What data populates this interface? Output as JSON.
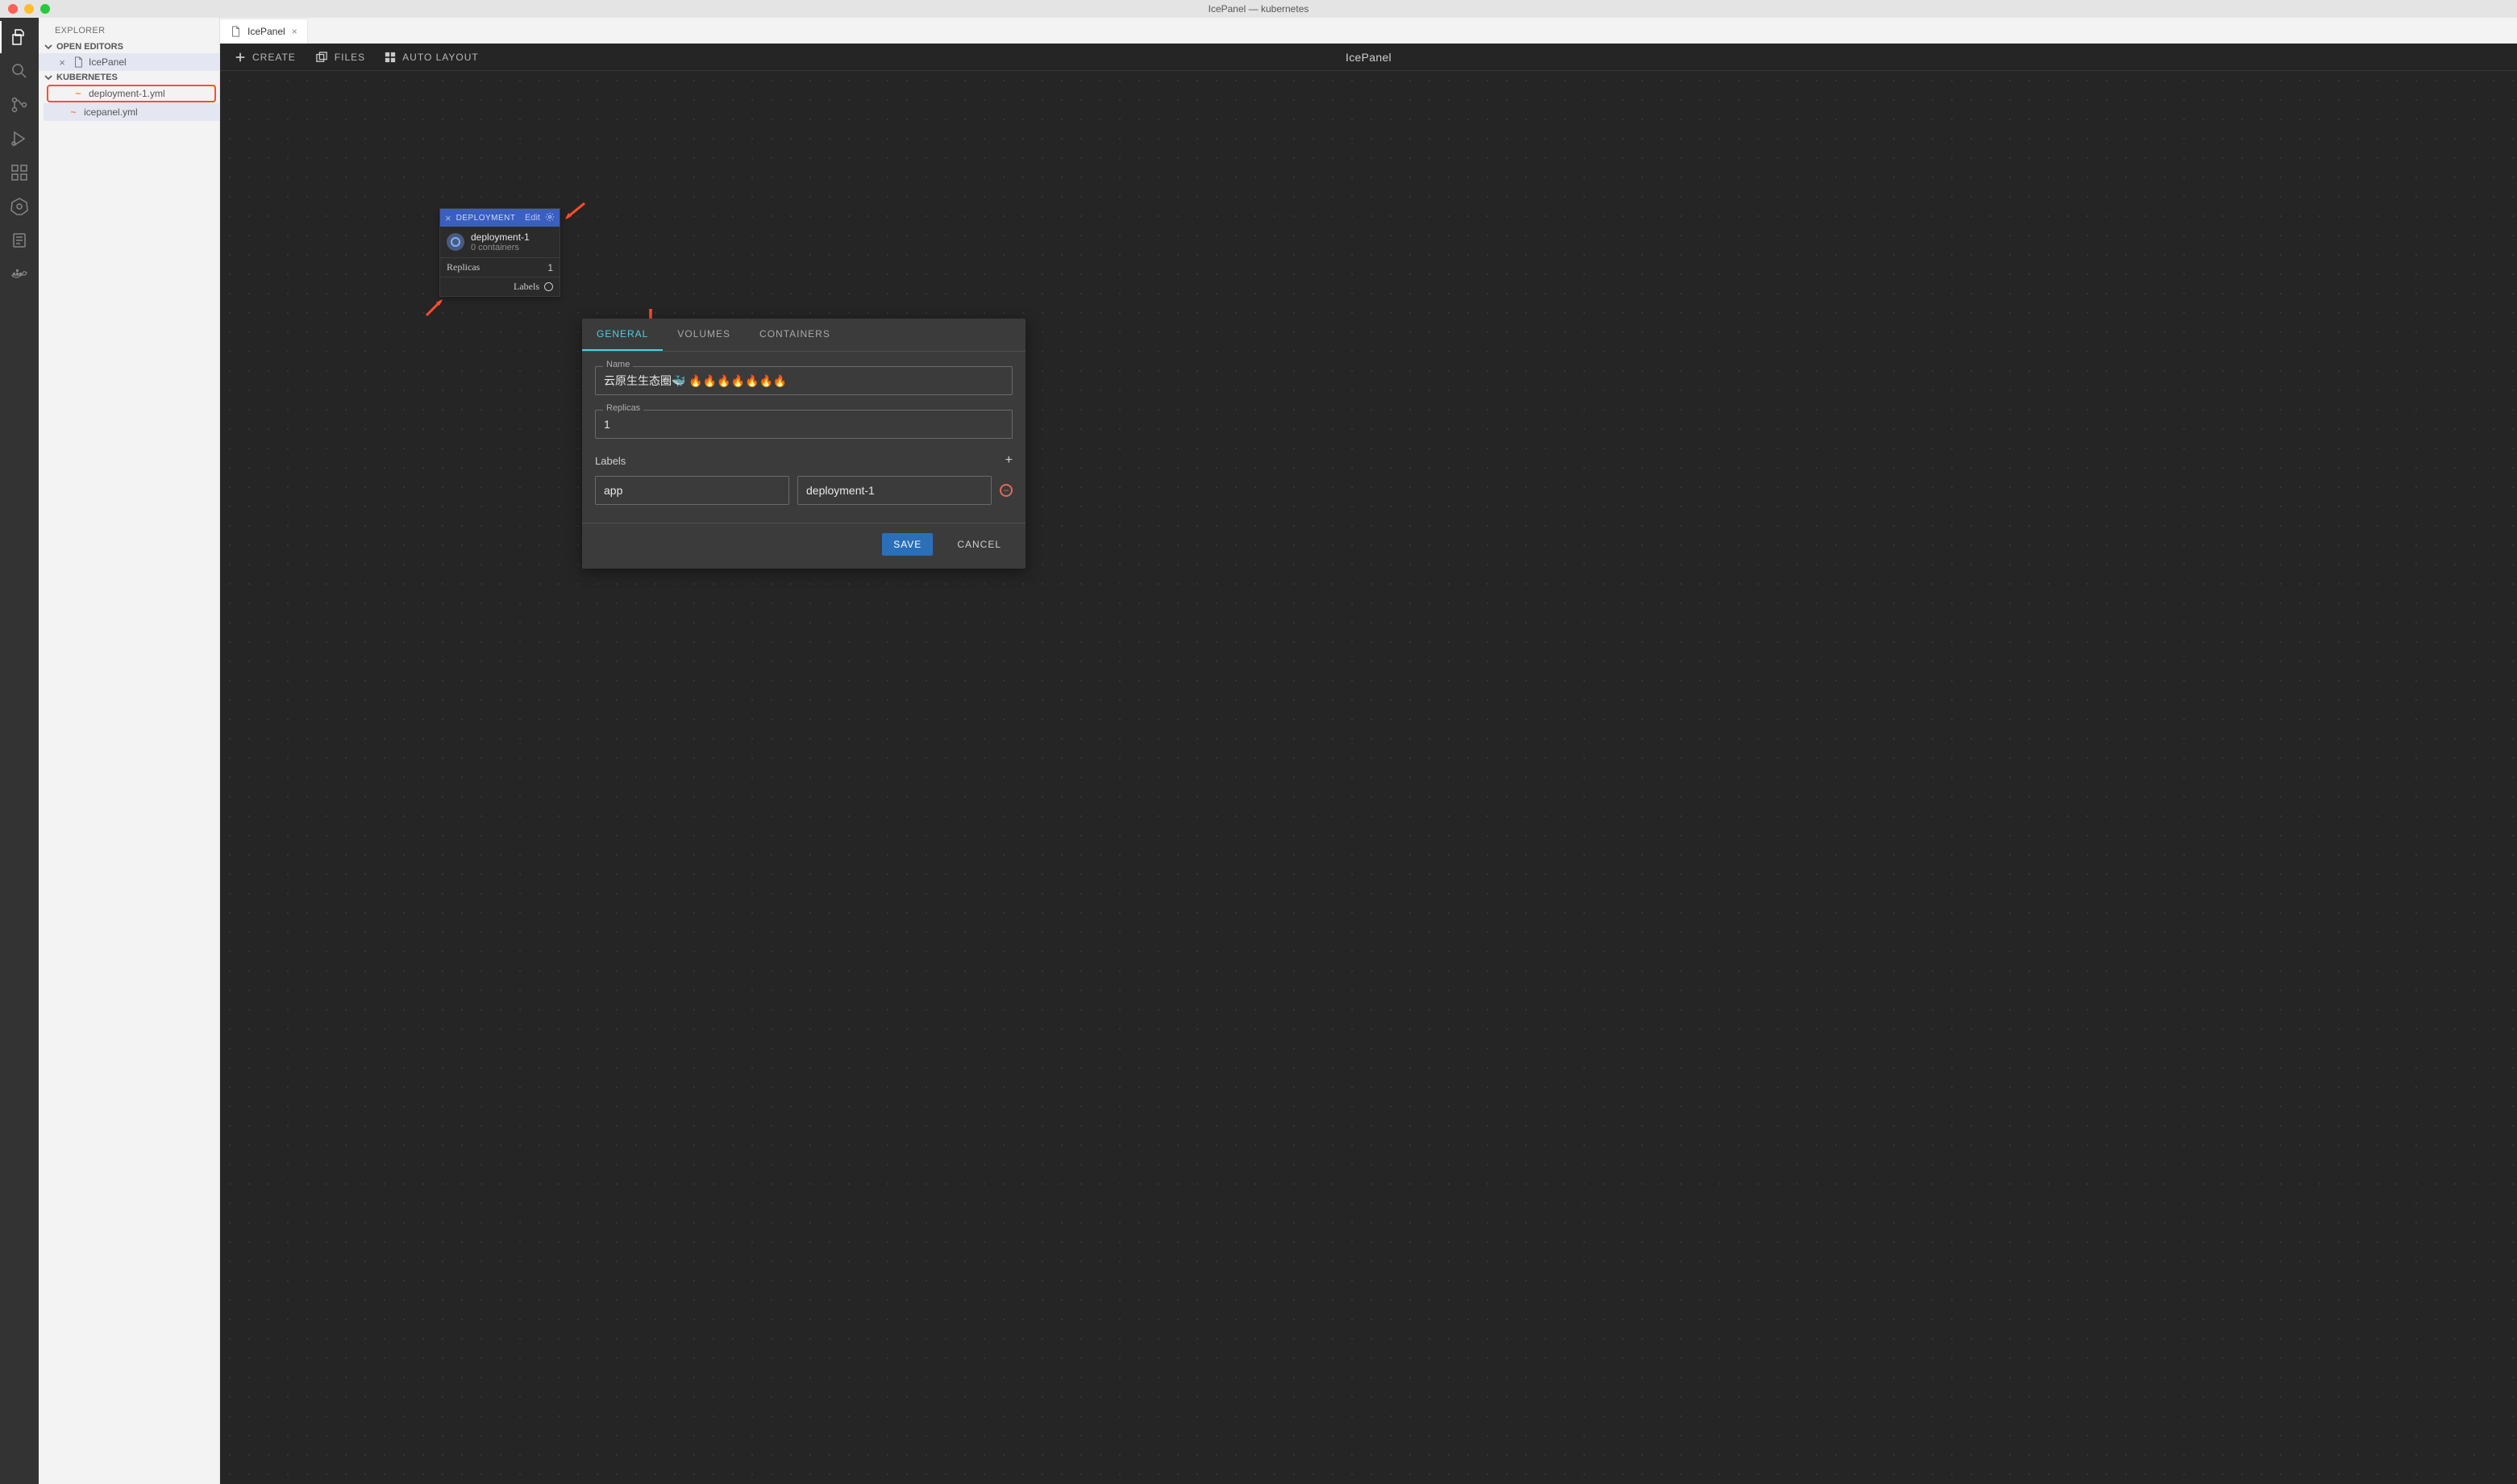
{
  "window": {
    "title": "IcePanel — kubernetes"
  },
  "sidebar": {
    "title": "EXPLORER",
    "open_editors": {
      "header": "OPEN EDITORS",
      "items": [
        {
          "label": "IcePanel"
        }
      ]
    },
    "workspace": {
      "header": "KUBERNETES",
      "files": [
        {
          "label": "deployment-1.yml",
          "highlighted": true
        },
        {
          "label": "icepanel.yml"
        }
      ]
    }
  },
  "tabs": [
    {
      "label": "IcePanel"
    }
  ],
  "toolbar": {
    "create": "CREATE",
    "files": "FILES",
    "auto_layout": "AUTO LAYOUT",
    "center_title": "IcePanel"
  },
  "node": {
    "type_label": "DEPLOYMENT",
    "edit_label": "Edit",
    "name": "deployment-1",
    "subtitle": "0 containers",
    "replicas_label": "Replicas",
    "replicas_value": "1",
    "labels_label": "Labels"
  },
  "panel": {
    "tabs": {
      "general": "GENERAL",
      "volumes": "VOLUMES",
      "containers": "CONTAINERS"
    },
    "name_label": "Name",
    "name_value": "云原生生态圈🐳 🔥🔥🔥🔥🔥🔥🔥",
    "replicas_label": "Replicas",
    "replicas_value": "1",
    "labels_header": "Labels",
    "label_key": "app",
    "label_value": "deployment-1",
    "save": "SAVE",
    "cancel": "CANCEL"
  }
}
